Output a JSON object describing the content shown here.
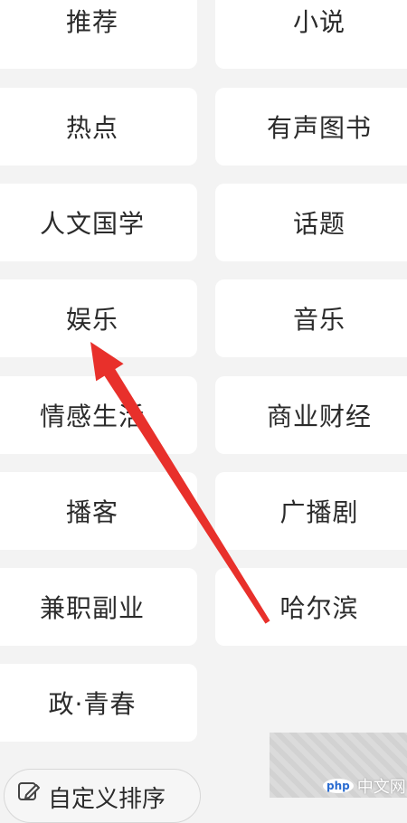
{
  "categories": [
    {
      "left": "推荐",
      "right": "小说"
    },
    {
      "left": "热点",
      "right": "有声图书"
    },
    {
      "left": "人文国学",
      "right": "话题"
    },
    {
      "left": "娱乐",
      "right": "音乐"
    },
    {
      "left": "情感生活",
      "right": "商业财经"
    },
    {
      "left": "播客",
      "right": "广播剧"
    },
    {
      "left": "兼职副业",
      "right": "哈尔滨"
    },
    {
      "left": "政·青春"
    }
  ],
  "custom_sort_label": "自定义排序",
  "watermark": {
    "php": "php",
    "text": "中文网"
  },
  "arrow_color": "#e8302b"
}
